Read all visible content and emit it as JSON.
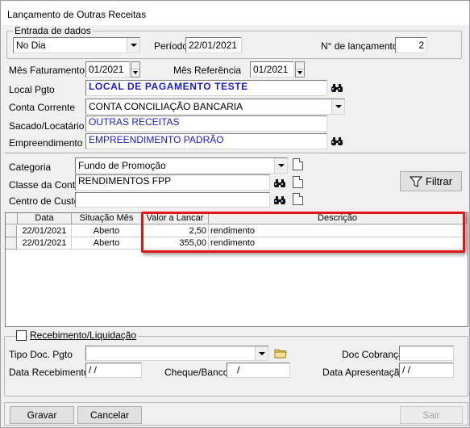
{
  "window": {
    "title": "Lançamento de Outras Receitas"
  },
  "entrada": {
    "legend": "Entrada de dados",
    "tipo_value": "No Dia",
    "periodo_label": "Período",
    "periodo_value": "22/01/2021",
    "n_lanc_label": "N° de lançamentos",
    "n_lanc_value": "2"
  },
  "form": {
    "mes_fat_label": "Mês Faturamento",
    "mes_fat_value": "01/2021",
    "mes_ref_label": "Mês Referência",
    "mes_ref_value": "01/2021",
    "local_label": "Local Pgto",
    "local_value": "LOCAL DE PAGAMENTO TESTE",
    "conta_label": "Conta Corrente",
    "conta_value": "CONTA CONCILIAÇÃO BANCARIA",
    "sacado_label": "Sacado/Locatário",
    "sacado_value": "OUTRAS RECEITAS",
    "emp_label": "Empreendimento",
    "emp_value": "EMPREENDIMENTO PADRÃO"
  },
  "filters": {
    "categoria_label": "Categoria",
    "categoria_value": "Fundo de Promoção",
    "classe_label": "Classe da Conta",
    "classe_value": "RENDIMENTOS FPP",
    "centro_label": "Centro de Custo",
    "centro_value": "",
    "filtrar_label": "Filtrar"
  },
  "grid": {
    "headers": [
      "Data",
      "Situação Mês",
      "Valor a Lancar",
      "Descrição"
    ],
    "rows": [
      {
        "data": "22/01/2021",
        "situacao": "Aberto",
        "valor": "2,50",
        "descricao": "rendimento"
      },
      {
        "data": "22/01/2021",
        "situacao": "Aberto",
        "valor": "355,00",
        "descricao": "rendimento"
      }
    ]
  },
  "recebimento": {
    "legend": "Recebimento/Liquidação",
    "tipo_doc_label": "Tipo Doc. Pgto",
    "tipo_doc_value": "",
    "doc_cobranca_label": "Doc Cobrança",
    "doc_cobranca_value": "",
    "data_receb_label": "Data Recebimento",
    "data_receb_value": " /  /",
    "cheque_label": "Cheque/Banco",
    "cheque_value": "/",
    "data_apres_label": "Data Apresentação",
    "data_apres_value": " /  /"
  },
  "buttons": {
    "gravar": "Gravar",
    "cancelar": "Cancelar",
    "sair": "Sair"
  },
  "colors": {
    "highlight": "#e01616",
    "field_text_blue": "#1b1bcf"
  }
}
